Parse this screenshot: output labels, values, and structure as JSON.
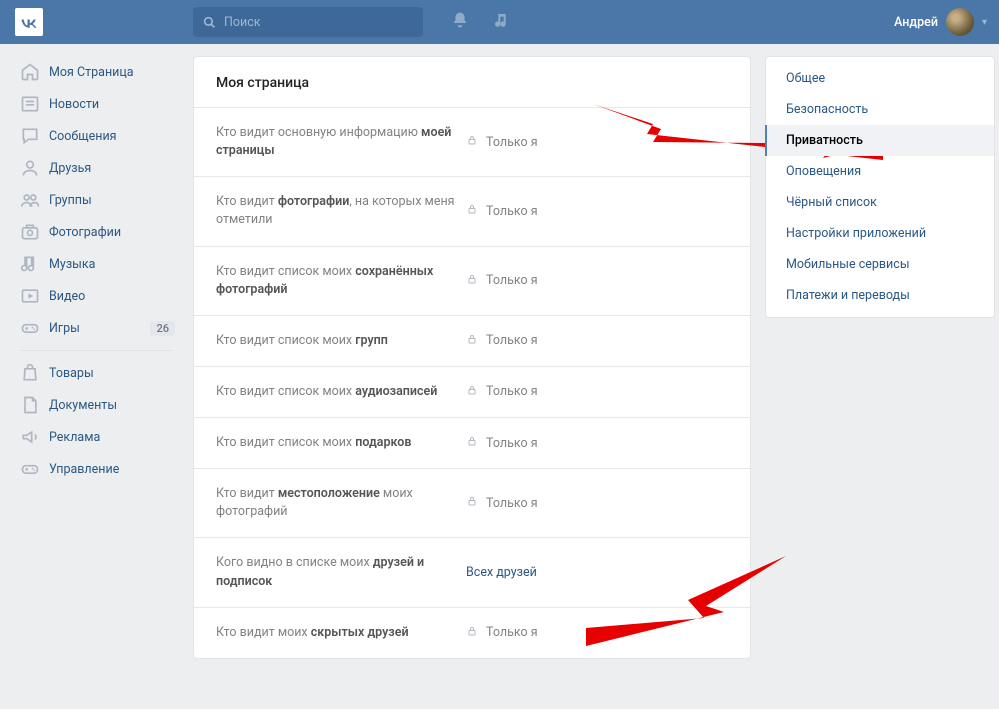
{
  "header": {
    "search_placeholder": "Поиск",
    "username": "Андрей"
  },
  "left_nav": {
    "items": [
      {
        "label": "Моя Страница",
        "icon": "home"
      },
      {
        "label": "Новости",
        "icon": "news"
      },
      {
        "label": "Сообщения",
        "icon": "chat"
      },
      {
        "label": "Друзья",
        "icon": "user"
      },
      {
        "label": "Группы",
        "icon": "group"
      },
      {
        "label": "Фотографии",
        "icon": "camera"
      },
      {
        "label": "Музыка",
        "icon": "music"
      },
      {
        "label": "Видео",
        "icon": "video"
      },
      {
        "label": "Игры",
        "icon": "game",
        "badge": "26"
      }
    ],
    "items2": [
      {
        "label": "Товары",
        "icon": "bag"
      },
      {
        "label": "Документы",
        "icon": "doc"
      },
      {
        "label": "Реклама",
        "icon": "mega"
      },
      {
        "label": "Управление",
        "icon": "game"
      }
    ]
  },
  "main": {
    "title": "Моя страница",
    "rows": [
      {
        "label_pre": "Кто видит основную информацию ",
        "label_bold": "моей страницы",
        "value": "Только я",
        "locked": true
      },
      {
        "label_pre": "Кто видит ",
        "label_bold": "фотографии",
        "label_post": ", на которых меня отметили",
        "value": "Только я",
        "locked": true
      },
      {
        "label_pre": "Кто видит список моих ",
        "label_bold": "сохранённых фотографий",
        "value": "Только я",
        "locked": true
      },
      {
        "label_pre": "Кто видит список моих ",
        "label_bold": "групп",
        "value": "Только я",
        "locked": true
      },
      {
        "label_pre": "Кто видит список моих ",
        "label_bold": "аудиозаписей",
        "value": "Только я",
        "locked": true
      },
      {
        "label_pre": "Кто видит список моих ",
        "label_bold": "подарков",
        "value": "Только я",
        "locked": true
      },
      {
        "label_pre": "Кто видит ",
        "label_bold": "местоположение",
        "label_post": " моих фотографий",
        "value": "Только я",
        "locked": true
      },
      {
        "label_pre": "Кого видно в списке моих ",
        "label_bold": "друзей и подписок",
        "value": "Всех друзей",
        "locked": false
      },
      {
        "label_pre": "Кто видит моих ",
        "label_bold": "скрытых друзей",
        "value": "Только я",
        "locked": true
      }
    ]
  },
  "right_nav": {
    "items": [
      {
        "label": "Общее",
        "active": false
      },
      {
        "label": "Безопасность",
        "active": false
      },
      {
        "label": "Приватность",
        "active": true
      },
      {
        "label": "Оповещения",
        "active": false
      },
      {
        "label": "Чёрный список",
        "active": false
      },
      {
        "label": "Настройки приложений",
        "active": false
      },
      {
        "label": "Мобильные сервисы",
        "active": false
      },
      {
        "label": "Платежи и переводы",
        "active": false
      }
    ]
  }
}
